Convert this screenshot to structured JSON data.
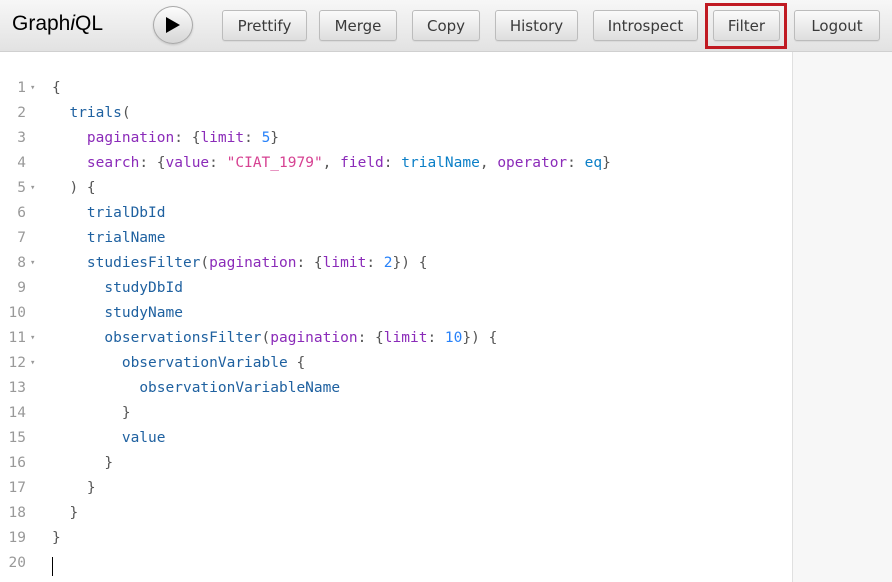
{
  "app": {
    "title_part1": "Graph",
    "title_italic": "i",
    "title_part2": "QL"
  },
  "toolbar": {
    "execute_icon": "play-icon",
    "buttons": [
      "Prettify",
      "Merge",
      "Copy",
      "History",
      "Introspect",
      "Filter",
      "Logout"
    ],
    "highlighted_button": "Filter",
    "highlight_color": "#c01a22"
  },
  "editor": {
    "lines": [
      {
        "n": "1",
        "fold": true,
        "tokens": [
          [
            "punct",
            "{"
          ]
        ]
      },
      {
        "n": "2",
        "fold": false,
        "tokens": [
          [
            "punct",
            "  "
          ],
          [
            "field",
            "trials"
          ],
          [
            "punct",
            "("
          ]
        ]
      },
      {
        "n": "3",
        "fold": false,
        "tokens": [
          [
            "punct",
            "    "
          ],
          [
            "attr",
            "pagination"
          ],
          [
            "punct",
            ": {"
          ],
          [
            "attr",
            "limit"
          ],
          [
            "punct",
            ": "
          ],
          [
            "num",
            "5"
          ],
          [
            "punct",
            "}"
          ]
        ]
      },
      {
        "n": "4",
        "fold": false,
        "tokens": [
          [
            "punct",
            "    "
          ],
          [
            "attr",
            "search"
          ],
          [
            "punct",
            ": {"
          ],
          [
            "attr",
            "value"
          ],
          [
            "punct",
            ": "
          ],
          [
            "str",
            "\"CIAT_1979\""
          ],
          [
            "punct",
            ", "
          ],
          [
            "attr",
            "field"
          ],
          [
            "punct",
            ": "
          ],
          [
            "enum",
            "trialName"
          ],
          [
            "punct",
            ", "
          ],
          [
            "attr",
            "operator"
          ],
          [
            "punct",
            ": "
          ],
          [
            "enum",
            "eq"
          ],
          [
            "punct",
            "}"
          ]
        ]
      },
      {
        "n": "5",
        "fold": true,
        "tokens": [
          [
            "punct",
            "  ) {"
          ]
        ]
      },
      {
        "n": "6",
        "fold": false,
        "tokens": [
          [
            "punct",
            "    "
          ],
          [
            "field",
            "trialDbId"
          ]
        ]
      },
      {
        "n": "7",
        "fold": false,
        "tokens": [
          [
            "punct",
            "    "
          ],
          [
            "field",
            "trialName"
          ]
        ]
      },
      {
        "n": "8",
        "fold": true,
        "tokens": [
          [
            "punct",
            "    "
          ],
          [
            "field",
            "studiesFilter"
          ],
          [
            "punct",
            "("
          ],
          [
            "attr",
            "pagination"
          ],
          [
            "punct",
            ": {"
          ],
          [
            "attr",
            "limit"
          ],
          [
            "punct",
            ": "
          ],
          [
            "num",
            "2"
          ],
          [
            "punct",
            "}) {"
          ]
        ]
      },
      {
        "n": "9",
        "fold": false,
        "tokens": [
          [
            "punct",
            "      "
          ],
          [
            "field",
            "studyDbId"
          ]
        ]
      },
      {
        "n": "10",
        "fold": false,
        "tokens": [
          [
            "punct",
            "      "
          ],
          [
            "field",
            "studyName"
          ]
        ]
      },
      {
        "n": "11",
        "fold": true,
        "tokens": [
          [
            "punct",
            "      "
          ],
          [
            "field",
            "observationsFilter"
          ],
          [
            "punct",
            "("
          ],
          [
            "attr",
            "pagination"
          ],
          [
            "punct",
            ": {"
          ],
          [
            "attr",
            "limit"
          ],
          [
            "punct",
            ": "
          ],
          [
            "num",
            "10"
          ],
          [
            "punct",
            "}) {"
          ]
        ]
      },
      {
        "n": "12",
        "fold": true,
        "tokens": [
          [
            "punct",
            "        "
          ],
          [
            "field",
            "observationVariable"
          ],
          [
            "punct",
            " {"
          ]
        ]
      },
      {
        "n": "13",
        "fold": false,
        "tokens": [
          [
            "punct",
            "          "
          ],
          [
            "field",
            "observationVariableName"
          ]
        ]
      },
      {
        "n": "14",
        "fold": false,
        "tokens": [
          [
            "punct",
            "        }"
          ]
        ]
      },
      {
        "n": "15",
        "fold": false,
        "tokens": [
          [
            "punct",
            "        "
          ],
          [
            "field",
            "value"
          ]
        ]
      },
      {
        "n": "16",
        "fold": false,
        "tokens": [
          [
            "punct",
            "      }"
          ]
        ]
      },
      {
        "n": "17",
        "fold": false,
        "tokens": [
          [
            "punct",
            "    }"
          ]
        ]
      },
      {
        "n": "18",
        "fold": false,
        "tokens": [
          [
            "punct",
            "  }"
          ]
        ]
      },
      {
        "n": "19",
        "fold": false,
        "tokens": [
          [
            "punct",
            "}"
          ]
        ]
      },
      {
        "n": "20",
        "fold": false,
        "tokens": [],
        "cursor": true
      }
    ],
    "fold_marker": "▾"
  }
}
